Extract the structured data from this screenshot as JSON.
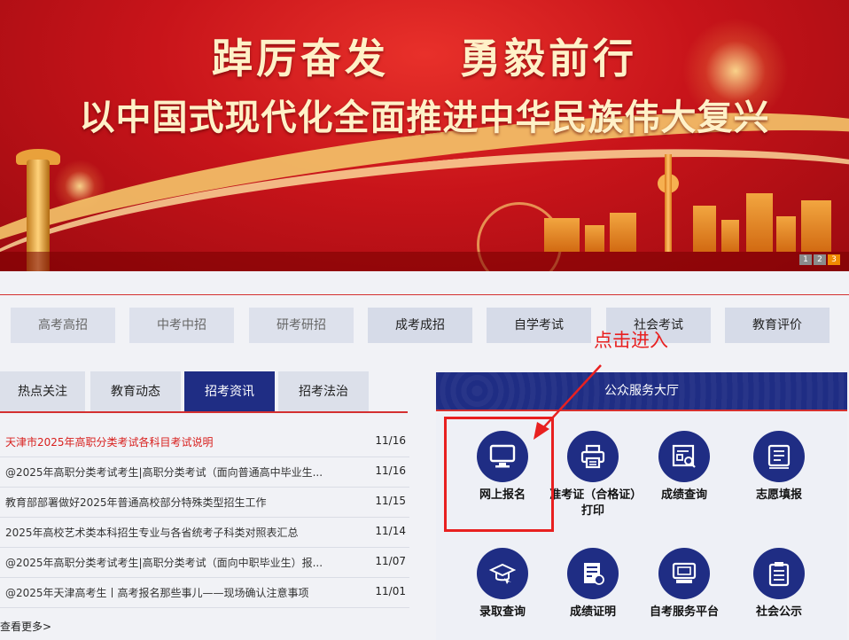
{
  "banner": {
    "slogan_line1": "踔厉奋发    勇毅前行",
    "slogan_line2": "以中国式现代化全面推进中华民族伟大复兴",
    "slides": [
      "1",
      "2",
      "3"
    ],
    "active_slide": 3
  },
  "category_nav": [
    {
      "label": "高考高招"
    },
    {
      "label": "中考中招"
    },
    {
      "label": "研考研招"
    },
    {
      "label": "成考成招"
    },
    {
      "label": "自学考试"
    },
    {
      "label": "社会考试"
    },
    {
      "label": "教育评价"
    }
  ],
  "news": {
    "tabs": [
      {
        "label": "热点关注"
      },
      {
        "label": "教育动态"
      },
      {
        "label": "招考资讯"
      },
      {
        "label": "招考法治"
      }
    ],
    "active_tab": "招考资讯",
    "items": [
      {
        "title": "天津市2025年高职分类考试各科目考试说明",
        "date": "11/16"
      },
      {
        "title": "@2025年高职分类考试考生|高职分类考试（面向普通高中毕业生...",
        "date": "11/16"
      },
      {
        "title": "教育部部署做好2025年普通高校部分特殊类型招生工作",
        "date": "11/15"
      },
      {
        "title": "2025年高校艺术类本科招生专业与各省统考子科类对照表汇总",
        "date": "11/14"
      },
      {
        "title": "@2025年高职分类考试考生|高职分类考试（面向中职毕业生）报...",
        "date": "11/07"
      },
      {
        "title": "@2025年天津高考生丨高考报名那些事儿——现场确认注意事项",
        "date": "11/01"
      }
    ],
    "more_label": "查看更多>"
  },
  "service_hall": {
    "title": "公众服务大厅",
    "items": [
      {
        "label": "网上报名",
        "icon": "monitor-icon"
      },
      {
        "label": "准考证（合格证）打印",
        "icon": "printer-icon"
      },
      {
        "label": "成绩查询",
        "icon": "score-search-icon"
      },
      {
        "label": "志愿填报",
        "icon": "form-fill-icon"
      },
      {
        "label": "录取查询",
        "icon": "graduation-cap-icon"
      },
      {
        "label": "成绩证明",
        "icon": "certificate-icon"
      },
      {
        "label": "自考服务平台",
        "icon": "computer-platform-icon"
      },
      {
        "label": "社会公示",
        "icon": "clipboard-icon"
      }
    ]
  },
  "annotation": {
    "text": "点击进入",
    "color": "#e82020"
  },
  "colors": {
    "primary_navy": "#1f2d84",
    "accent_red": "#d43030",
    "banner_red": "#c8141a",
    "slide_active": "#f08a00"
  }
}
